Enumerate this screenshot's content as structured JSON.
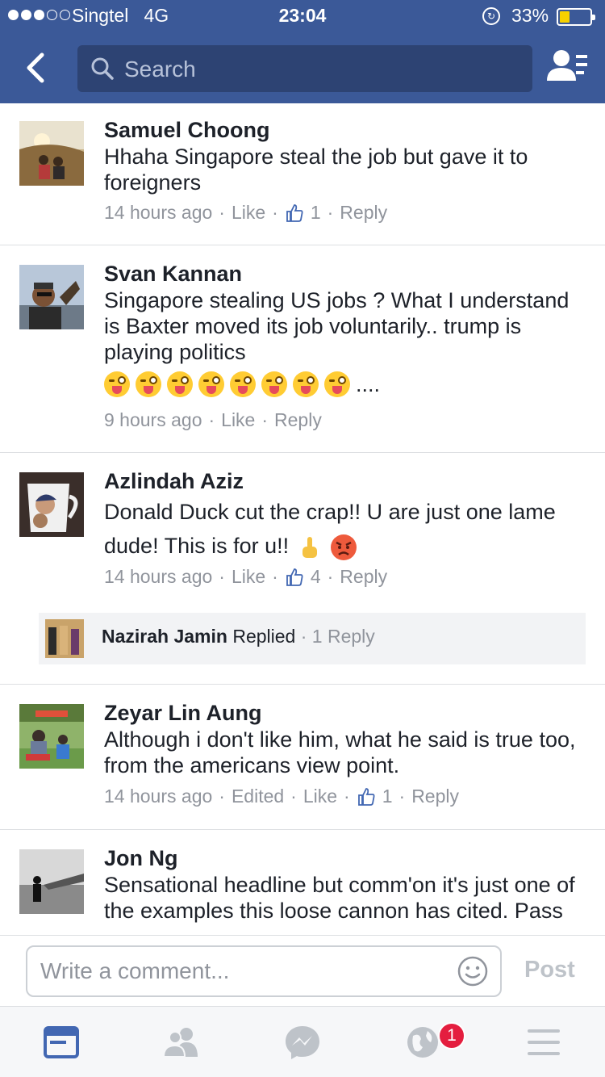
{
  "status_bar": {
    "carrier": "Singtel",
    "network": "4G",
    "time": "23:04",
    "battery_percent": "33%",
    "battery_level": 0.33,
    "battery_fill_color": "#f7d100"
  },
  "header": {
    "search_placeholder": "Search",
    "bg_color": "#3b5998"
  },
  "comments": [
    {
      "name": "Samuel Choong",
      "text": "Hhaha Singapore steal the job but gave it to foreigners",
      "time": "14 hours ago",
      "like_label": "Like",
      "like_count": "1",
      "reply_label": "Reply"
    },
    {
      "name": "Svan Kannan",
      "text": "Singapore stealing US jobs ? What I understand is Baxter moved its job voluntarily.. trump is playing politics",
      "emoji_tail": "....",
      "emoji_name": "winking-tongue-emoji",
      "time": "9 hours ago",
      "like_label": "Like",
      "reply_label": "Reply"
    },
    {
      "name": "Azlindah Aziz",
      "text": "Donald Duck cut the crap!! U are just one lame dude! This is for u!!",
      "emojis": [
        "middle-finger-emoji",
        "angry-face-emoji"
      ],
      "time": "14 hours ago",
      "like_label": "Like",
      "like_count": "4",
      "reply_label": "Reply",
      "reply_preview": {
        "name": "Nazirah Jamin",
        "action": "Replied",
        "count_label": "1 Reply"
      }
    },
    {
      "name": "Zeyar Lin Aung",
      "text": "Although i don't like him, what he said is true too, from the americans view point.",
      "time": "14 hours ago",
      "edited_label": "Edited",
      "like_label": "Like",
      "like_count": "1",
      "reply_label": "Reply"
    },
    {
      "name": "Jon Ng",
      "text": "Sensational headline but comm'on it's just one of the examples this loose cannon has cited. Pass"
    }
  ],
  "composer": {
    "placeholder": "Write a comment...",
    "post_label": "Post"
  },
  "tabbar": {
    "tabs": [
      "news-feed-icon",
      "friends-icon",
      "messenger-icon",
      "notifications-globe-icon",
      "menu-icon"
    ],
    "notification_badge": "1",
    "active_color": "#4267b2",
    "inactive_color": "#bec3c9"
  }
}
